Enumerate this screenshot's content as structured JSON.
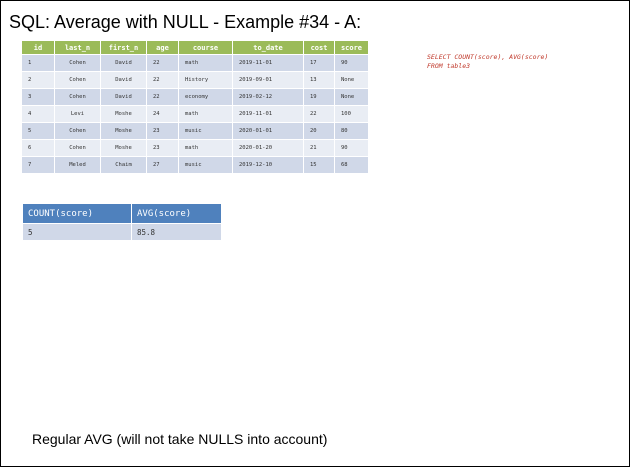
{
  "slide": {
    "title": "SQL: Average with NULL - Example #34 - A:",
    "footer": "Regular AVG (will not take NULLS into account)"
  },
  "table3": {
    "headers": [
      "id",
      "last_n",
      "first_n",
      "age",
      "course",
      "to_date",
      "cost",
      "score"
    ],
    "rows": [
      [
        "1",
        "Cohen",
        "David",
        "22",
        "math",
        "2019-11-01",
        "17",
        "90"
      ],
      [
        "2",
        "Cohen",
        "David",
        "22",
        "History",
        "2019-09-01",
        "13",
        "None"
      ],
      [
        "3",
        "Cohen",
        "David",
        "22",
        "economy",
        "2019-02-12",
        "19",
        "None"
      ],
      [
        "4",
        "Levi",
        "Moshe",
        "24",
        "math",
        "2019-11-01",
        "22",
        "100"
      ],
      [
        "5",
        "Cohen",
        "Moshe",
        "23",
        "music",
        "2020-01-01",
        "20",
        "80"
      ],
      [
        "6",
        "Cohen",
        "Moshe",
        "23",
        "math",
        "2020-01-20",
        "21",
        "90"
      ],
      [
        "7",
        "Meled",
        "Chaim",
        "27",
        "music",
        "2019-12-10",
        "15",
        "68"
      ]
    ]
  },
  "query": {
    "line1": "SELECT COUNT(score), AVG(score)",
    "line2": "FROM table3"
  },
  "result": {
    "headers": [
      "COUNT(score)",
      "AVG(score)"
    ],
    "row": [
      "5",
      "85.8"
    ]
  }
}
